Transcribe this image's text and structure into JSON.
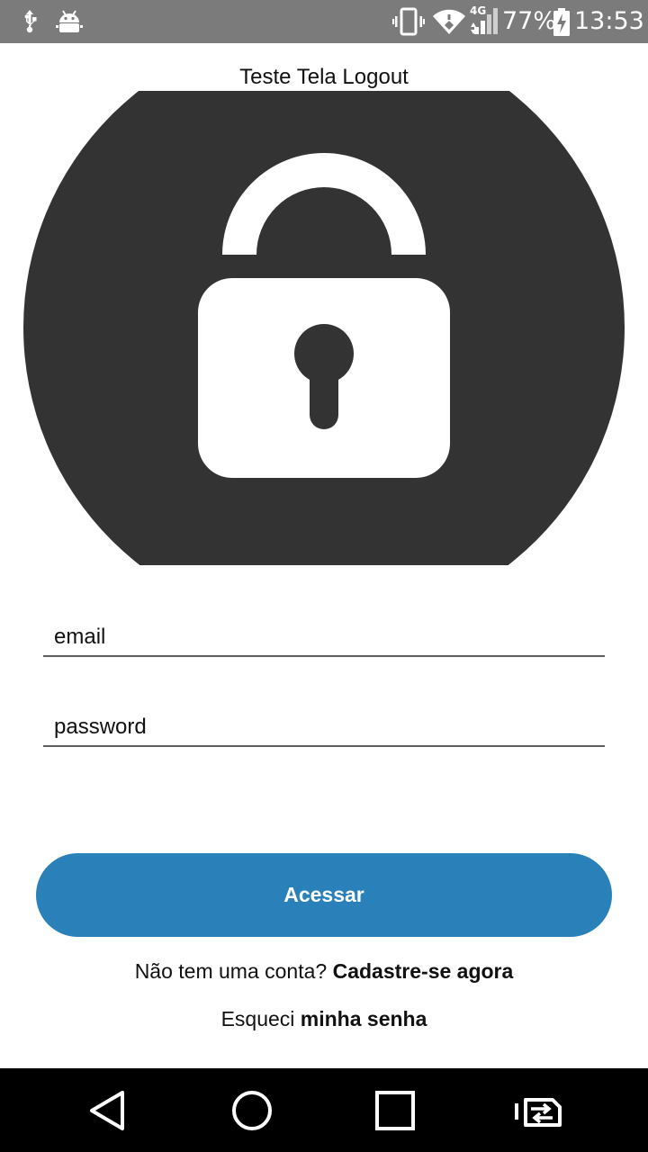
{
  "status_bar": {
    "network_label": "4G",
    "battery_percent": "77%",
    "time": "13:53",
    "icons": [
      "usb-icon",
      "android-debug-icon",
      "vibrate-icon",
      "wifi-icon",
      "signal-icon",
      "battery-charging-icon"
    ]
  },
  "header": {
    "title": "Teste Tela Logout"
  },
  "hero": {
    "icon": "lock-icon",
    "circle_color": "#333333"
  },
  "form": {
    "email_placeholder": "email",
    "password_placeholder": "password",
    "submit_label": "Acessar",
    "accent_color": "#2a80b8"
  },
  "links": {
    "signup_prefix": "Não tem uma conta?",
    "signup_action": "Cadastre-se agora",
    "forgot_prefix": "Esqueci",
    "forgot_action": "minha senha"
  },
  "nav_bar": {
    "icons": [
      "back-icon",
      "home-icon",
      "recents-icon",
      "switch-sim-icon"
    ]
  }
}
